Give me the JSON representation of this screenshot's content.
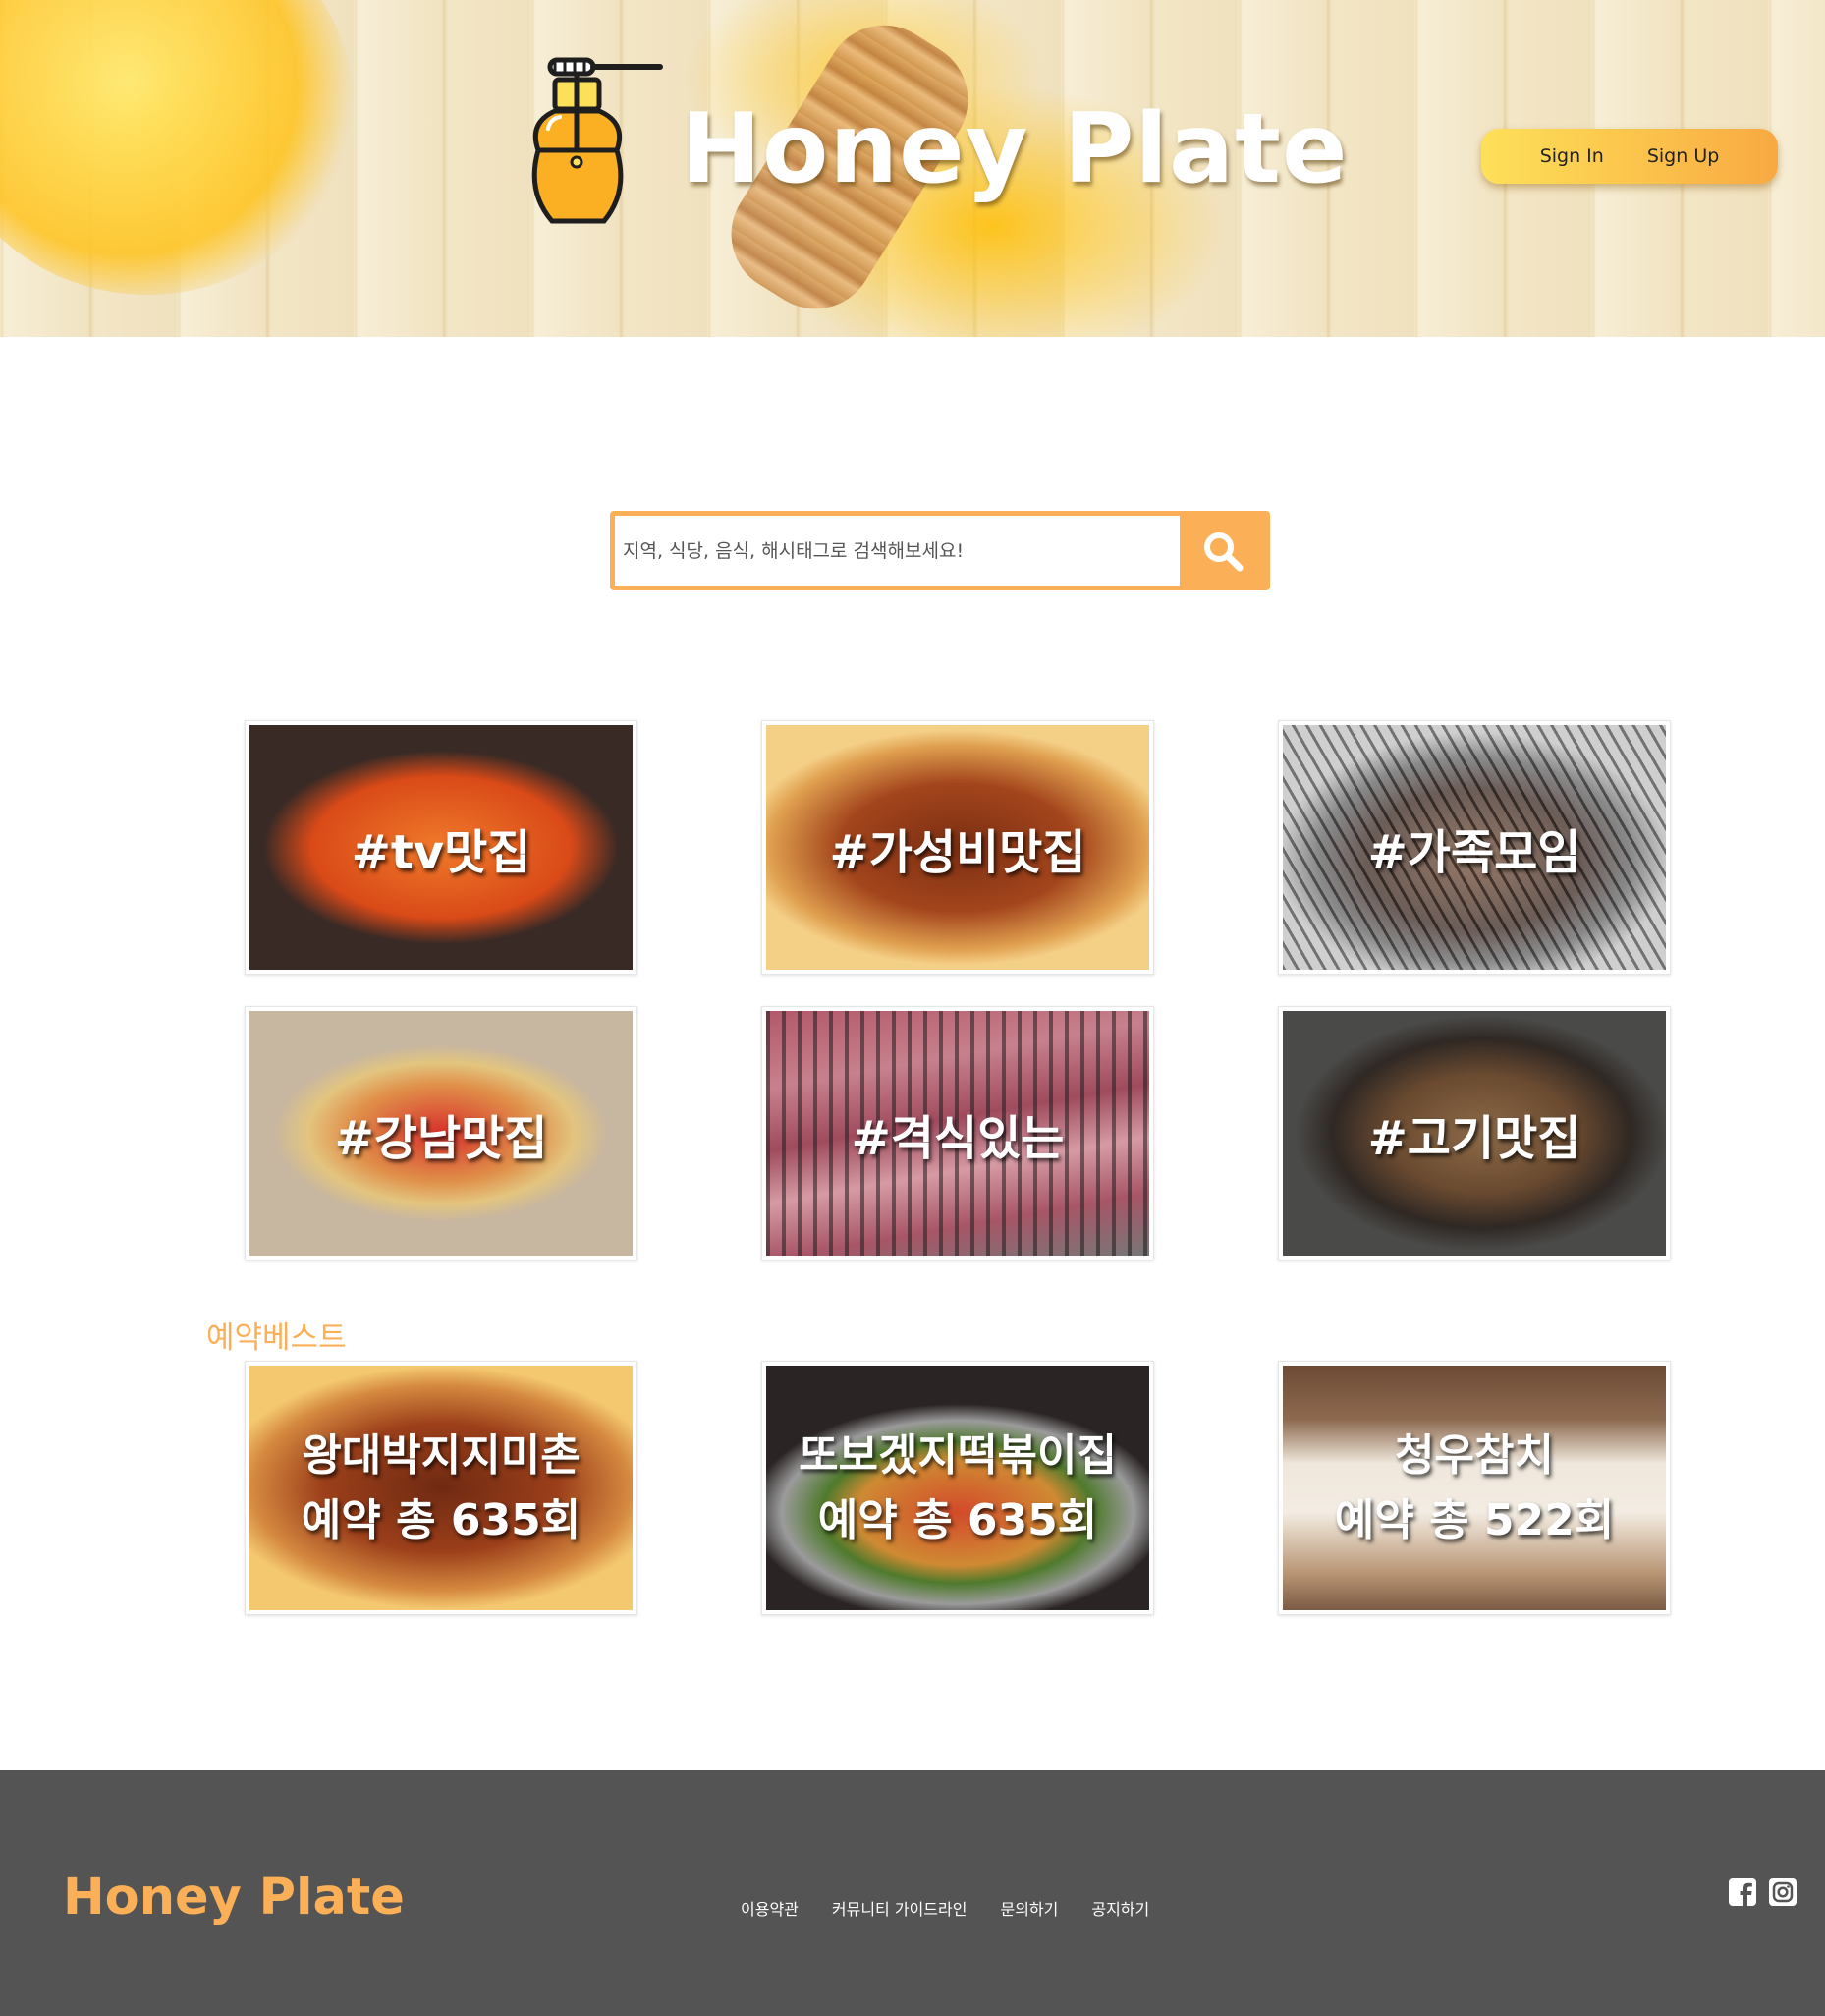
{
  "header": {
    "title": "Honey Plate",
    "sign_in": "Sign In",
    "sign_up": "Sign Up",
    "logo_icon": "honey-pot-icon"
  },
  "search": {
    "placeholder": "지역, 식당, 음식, 해시태그로 검색해보세요!",
    "value": "",
    "button_icon": "search-icon"
  },
  "hashtags": [
    {
      "label": "#tv맛집"
    },
    {
      "label": "#가성비맛집"
    },
    {
      "label": "#가족모임"
    },
    {
      "label": "#강남맛집"
    },
    {
      "label": "#격식있는"
    },
    {
      "label": "#고기맛집"
    }
  ],
  "best": {
    "title": "예약베스트",
    "items": [
      {
        "name": "왕대박지지미촌",
        "count": "예약 총 635회"
      },
      {
        "name": "또보겠지떡볶이집",
        "count": "예약 총 635회"
      },
      {
        "name": "청우참치",
        "count": "예약 총 522회"
      }
    ]
  },
  "footer": {
    "logo": "Honey Plate",
    "links": [
      "이용약관",
      "커뮤니티 가이드라인",
      "문의하기",
      "공지하기"
    ],
    "social_icons": [
      "facebook-icon",
      "instagram-icon"
    ]
  },
  "colors": {
    "accent": "#fbb057",
    "footer_bg": "#545454",
    "auth_gradient_start": "#fde05a",
    "auth_gradient_end": "#f8a942"
  }
}
